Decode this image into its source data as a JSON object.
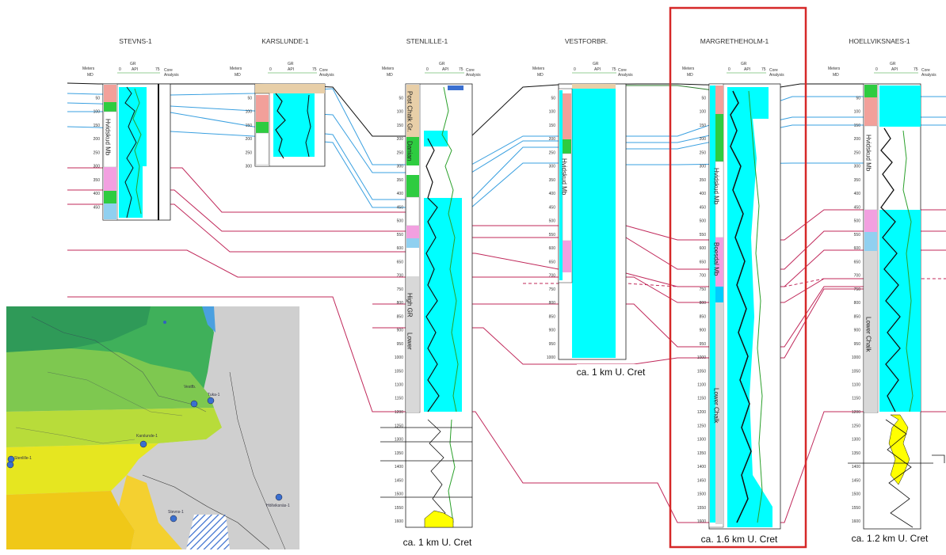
{
  "wells": [
    {
      "name": "STEVNS-1",
      "ticks": [
        "50",
        "100",
        "150",
        "200",
        "250",
        "300",
        "350",
        "400",
        "450"
      ]
    },
    {
      "name": "KARSLUNDE-1",
      "ticks": [
        "50",
        "100",
        "150",
        "200",
        "250",
        "300"
      ]
    },
    {
      "name": "STENLILLE-1",
      "ticks": [
        "50",
        "100",
        "150",
        "200",
        "250",
        "300",
        "350",
        "400",
        "450",
        "500",
        "550",
        "600",
        "650",
        "700",
        "750",
        "800",
        "850",
        "900",
        "950",
        "1000",
        "1050",
        "1100",
        "1150",
        "1200",
        "1250",
        "1300",
        "1350",
        "1400",
        "1450",
        "1500",
        "1550",
        "1600"
      ]
    },
    {
      "name": "VESTFORBR.",
      "ticks": [
        "50",
        "100",
        "150",
        "200",
        "250",
        "300",
        "350",
        "400",
        "450",
        "500",
        "550",
        "600",
        "650",
        "700",
        "750",
        "800",
        "850",
        "900",
        "950",
        "1000"
      ]
    },
    {
      "name": "MARGRETHEHOLM-1",
      "ticks": [
        "50",
        "100",
        "150",
        "200",
        "250",
        "300",
        "350",
        "400",
        "450",
        "500",
        "550",
        "600",
        "650",
        "700",
        "750",
        "800",
        "850",
        "900",
        "950",
        "1000",
        "1050",
        "1100",
        "1150",
        "1200",
        "1250",
        "1300",
        "1350",
        "1400",
        "1450",
        "1500",
        "1550",
        "1600"
      ]
    },
    {
      "name": "HOELLVIKSNAES-1",
      "ticks": [
        "50",
        "100",
        "150",
        "200",
        "250",
        "300",
        "350",
        "400",
        "450",
        "500",
        "550",
        "600",
        "650",
        "700",
        "750",
        "800",
        "850",
        "900",
        "950",
        "1000",
        "1050",
        "1100",
        "1150",
        "1200",
        "1250",
        "1300",
        "1350",
        "1400",
        "1450",
        "1500",
        "1550",
        "1600"
      ]
    }
  ],
  "header": {
    "meters": "Meters",
    "md": "MD",
    "gr": "GR",
    "api": "API",
    "api_min": "0",
    "api_max": "75",
    "core": "Core",
    "analysis": "Analysis"
  },
  "units": {
    "stevns_hvidskud": "Hvidskud Mb",
    "stenlille_post_chalk": "Post Chalk Gr.",
    "stenlille_danian": "Danian",
    "stenlille_high_gr": "High GR",
    "stenlille_lower": "Lower",
    "vestforbr_hvidskud": "Hvidskud Mb",
    "margretheholm_hvidskud": "Hvidskud Mb",
    "margretheholm_boesdal": "Boesdal Mb",
    "margretheholm_lower_chalk": "Lower Chalk",
    "hoellviksnaes_hvidskud": "Hvidskud Mb",
    "hoellviksnaes_lower_chalk": "Lower Chalk"
  },
  "captions": {
    "stenlille": "ca. 1 km U. Cret",
    "vestforbr": "ca. 1 km U. Cret",
    "margretheholm": "ca. 1.6 km U. Cret",
    "hoellviksnaes": "ca. 1.2 km U. Cret"
  },
  "map_labels": {
    "vestforb": "Vestfb.",
    "tuka": "Tuka-1",
    "karslunde": "Karslunde-1",
    "stenlille": "Stenlille-1",
    "stevns": "Stevns-1",
    "hollviksnas": "Höllviksnäs-1"
  },
  "colors": {
    "highlight_box": "#d62828",
    "log_fill": "#00ffff",
    "gr_curve": "#2aa02a",
    "correlation_blue": "#3aa0e0",
    "correlation_red": "#c0285a"
  }
}
